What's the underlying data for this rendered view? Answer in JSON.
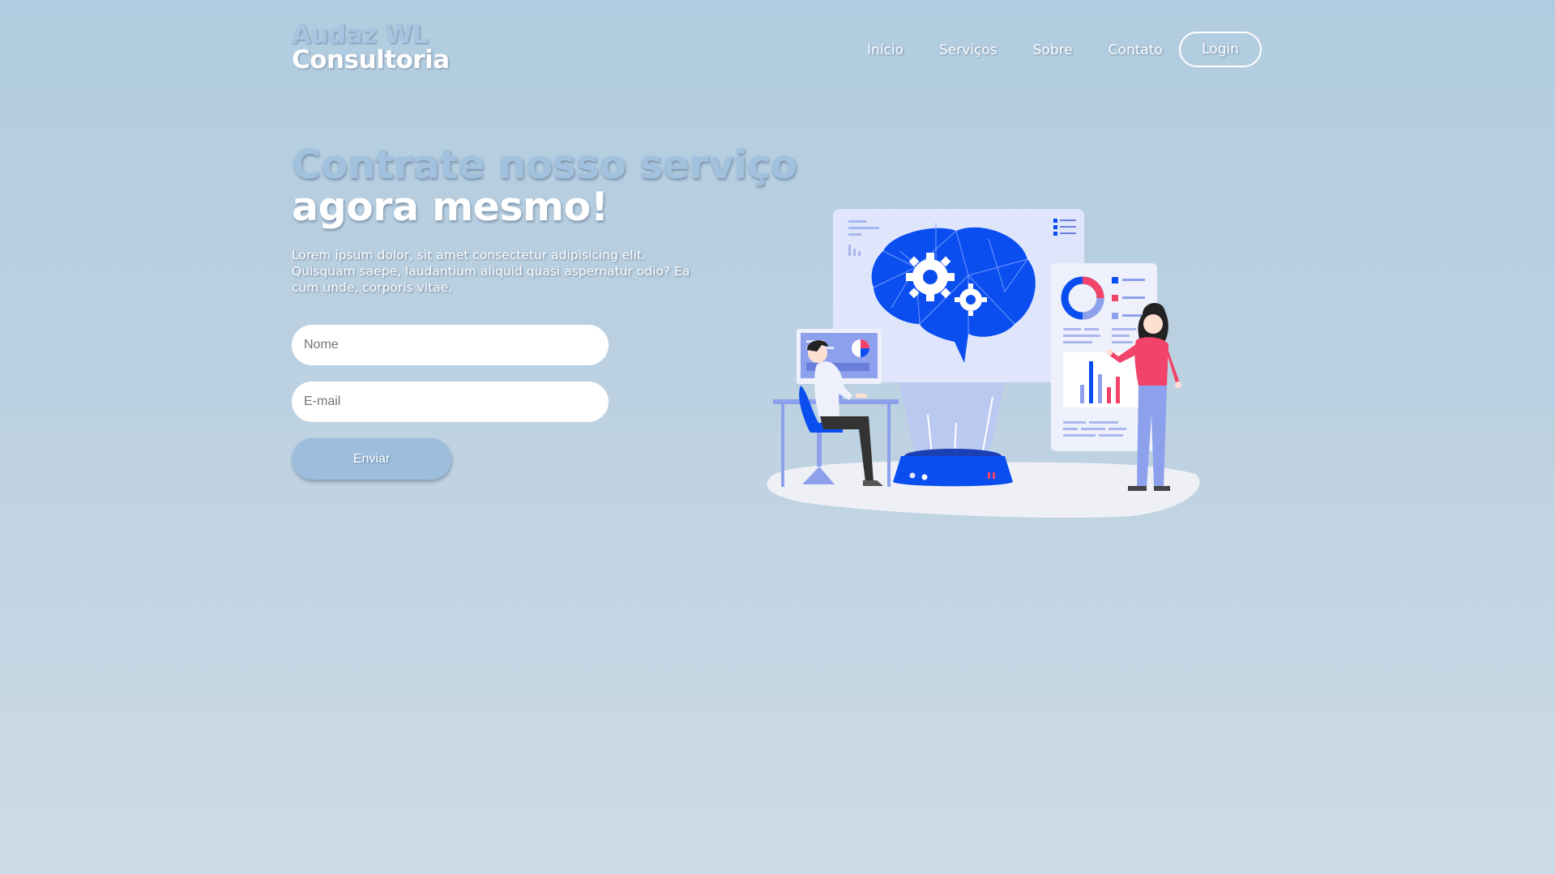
{
  "brand": {
    "line1": "Audaz WL",
    "line2": "Consultoria"
  },
  "nav": {
    "items": [
      {
        "label": "Início"
      },
      {
        "label": "Serviços"
      },
      {
        "label": "Sobre"
      },
      {
        "label": "Contato"
      }
    ],
    "login_label": "Login"
  },
  "hero": {
    "title_line1": "Contrate nosso serviço",
    "title_line2": "agora mesmo!",
    "description": "Lorem ipsum dolor, sit amet consectetur adipisicing elit. Quisquam saepe, laudantium aliquid quasi aspernatur odio? Ea cum unde, corporis vitae."
  },
  "form": {
    "name_placeholder": "Nome",
    "email_placeholder": "E-mail",
    "submit_label": "Enviar"
  },
  "illustration": {
    "icon": "consulting-ai-brain-illustration"
  },
  "colors": {
    "accent_blue": "#0a4ef0",
    "light_blue": "#a2c1de",
    "pink": "#f2436a",
    "periwinkle": "#8da0ec"
  }
}
